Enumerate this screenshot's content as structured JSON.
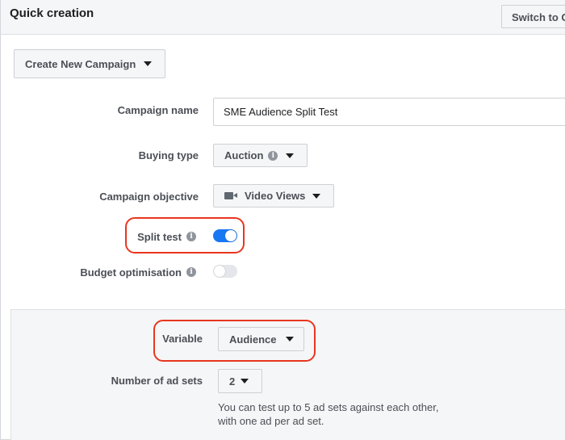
{
  "header": {
    "title": "Quick creation",
    "switch_label": "Switch to Guided creation"
  },
  "create_button": {
    "label": "Create New Campaign",
    "icon": "caret-down-icon"
  },
  "form": {
    "campaign_name": {
      "label": "Campaign name",
      "value": "SME Audience Split Test"
    },
    "buying_type": {
      "label": "Buying type",
      "value": "Auction",
      "icon": "info-icon"
    },
    "campaign_objective": {
      "label": "Campaign objective",
      "value": "Video Views",
      "icon": "video-camera-icon"
    },
    "split_test": {
      "label": "Split test",
      "on": true
    },
    "budget_optimisation": {
      "label": "Budget optimisation",
      "on": false
    }
  },
  "split_panel": {
    "variable": {
      "label": "Variable",
      "value": "Audience"
    },
    "ad_sets": {
      "label": "Number of ad sets",
      "value": "2"
    },
    "help_line1": "You can test up to 5 ad sets against each other,",
    "help_line2": "with one ad per ad set."
  },
  "colors": {
    "accent": "#1877f2",
    "highlight": "#e8361f",
    "panel_bg": "#f5f6f7"
  }
}
